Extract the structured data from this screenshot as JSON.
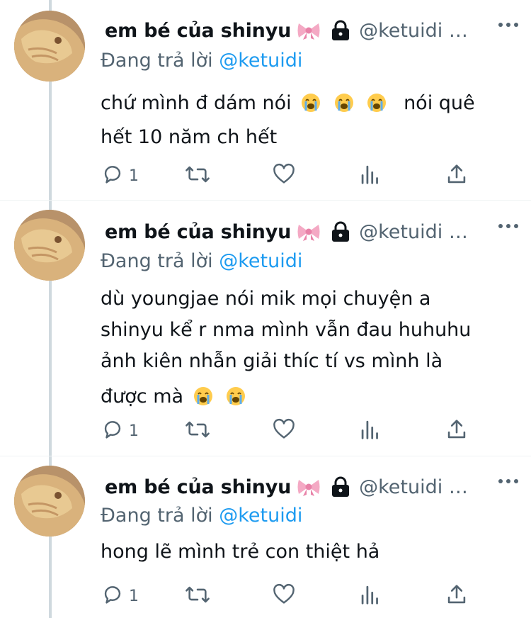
{
  "tweets": [
    {
      "display_name": "em bé của shinyu",
      "name_emoji_icon": "ribbon-icon",
      "protected_icon": "lock-icon",
      "handle": "@ketuidi …",
      "replying_prefix": "Đang trả lời",
      "replying_to": "@ketuidi",
      "lines": [
        "chứ mình đ dám nói",
        "hết 10 năm ch hết"
      ],
      "line1_after_emoji": "nói quê",
      "emojis": [
        "loudly-crying-face",
        "loudly-crying-face",
        "loudly-crying-face"
      ],
      "reply_count": "1"
    },
    {
      "display_name": "em bé của shinyu",
      "name_emoji_icon": "ribbon-icon",
      "protected_icon": "lock-icon",
      "handle": "@ketuidi …",
      "replying_prefix": "Đang trả lời",
      "replying_to": "@ketuidi",
      "lines": [
        "dù youngjae nói mik mọi chuyện a",
        "shinyu kể r nma mình vẫn đau huhuhu",
        "ảnh kiên nhẫn giải thíc tí vs mình là",
        "được mà"
      ],
      "emojis": [
        "loudly-crying-face",
        "loudly-crying-face"
      ],
      "reply_count": "1"
    },
    {
      "display_name": "em bé của shinyu",
      "name_emoji_icon": "ribbon-icon",
      "protected_icon": "lock-icon",
      "handle": "@ketuidi …",
      "replying_prefix": "Đang trả lời",
      "replying_to": "@ketuidi",
      "lines": [
        "hong lẽ mình trẻ con thiệt hả"
      ],
      "reply_count": "1"
    }
  ],
  "action_icons": [
    "reply-icon",
    "retweet-icon",
    "like-icon",
    "views-icon",
    "share-icon"
  ],
  "colors": {
    "text": "#0f1419",
    "secondary": "#536471",
    "mention": "#1d9bf0",
    "thread_line": "#cfd9de"
  }
}
